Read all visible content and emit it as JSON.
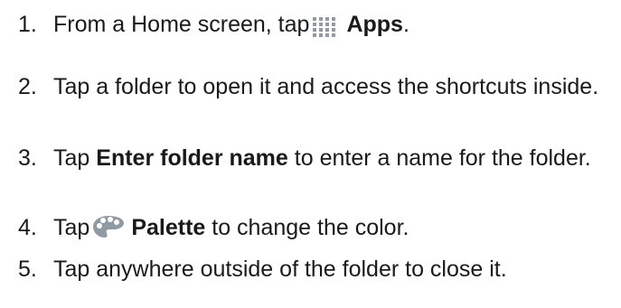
{
  "steps": [
    {
      "number": "1.",
      "before": "From a Home screen, tap",
      "icon": "apps-grid-icon",
      "bold": "Apps",
      "after": "."
    },
    {
      "number": "2.",
      "text": "Tap a folder to open it and access the shortcuts inside."
    },
    {
      "number": "3.",
      "before": "Tap ",
      "bold": "Enter folder name",
      "after": " to enter a name for the folder."
    },
    {
      "number": "4.",
      "before": "Tap",
      "icon": "palette-icon",
      "bold": "Palette",
      "after": " to change the color."
    },
    {
      "number": "5.",
      "text": "Tap anywhere outside of the folder to close it."
    }
  ],
  "colors": {
    "text": "#1a1a1a",
    "icon_gray": "#8f9aa3"
  }
}
